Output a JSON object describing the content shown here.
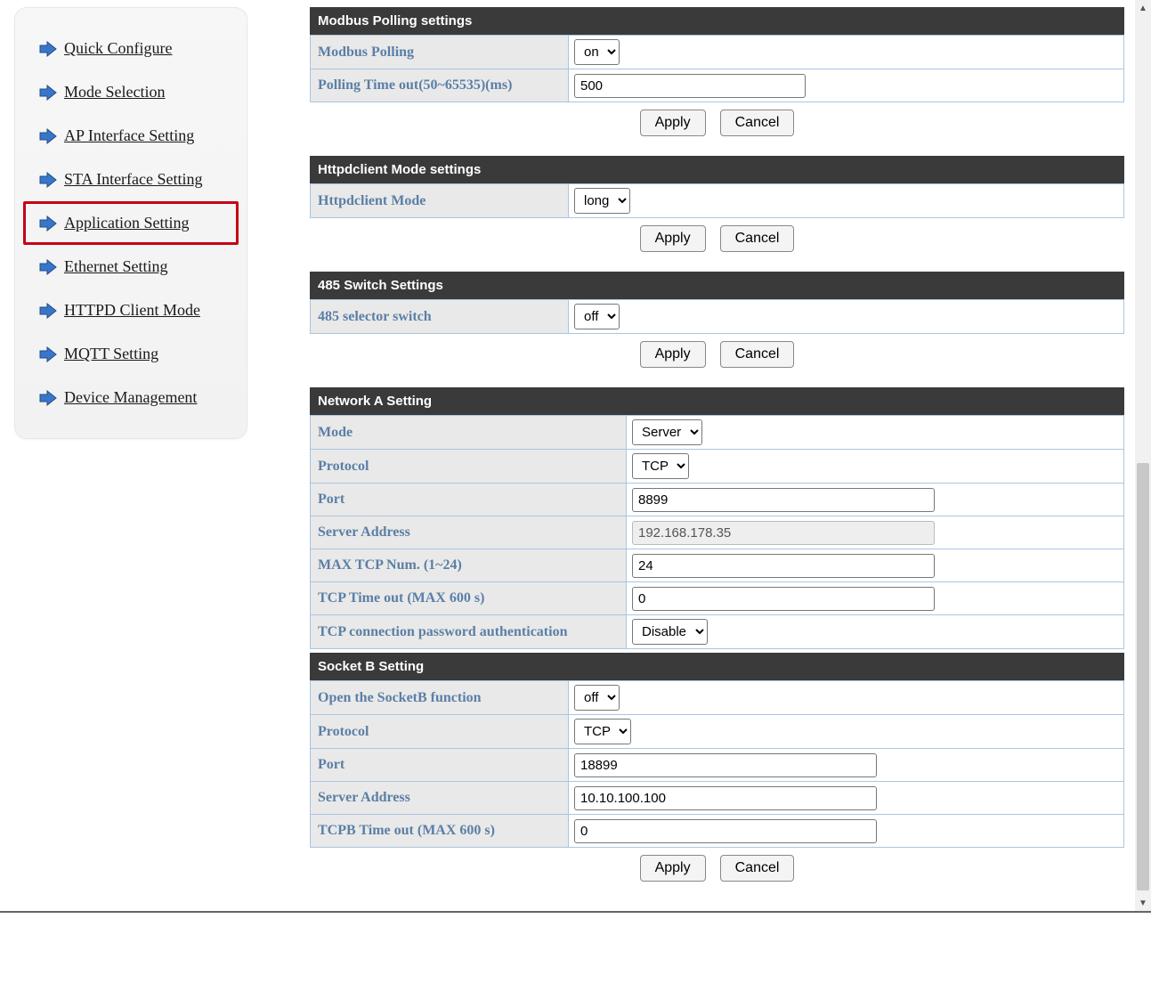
{
  "sidebar": {
    "items": [
      {
        "label": "Quick Configure"
      },
      {
        "label": "Mode Selection"
      },
      {
        "label": "AP Interface Setting"
      },
      {
        "label": "STA Interface Setting"
      },
      {
        "label": "Application Setting",
        "highlighted": true
      },
      {
        "label": "Ethernet Setting"
      },
      {
        "label": "HTTPD Client Mode"
      },
      {
        "label": "MQTT Setting"
      },
      {
        "label": "Device Management"
      }
    ]
  },
  "buttons": {
    "apply": "Apply",
    "cancel": "Cancel"
  },
  "sections": {
    "modbus": {
      "title": "Modbus Polling settings",
      "polling_label": "Modbus Polling",
      "polling_value": "on",
      "timeout_label": "Polling Time out(50~65535)(ms)",
      "timeout_value": "500"
    },
    "httpd": {
      "title": "Httpdclient Mode settings",
      "mode_label": "Httpdclient Mode",
      "mode_value": "long"
    },
    "switch485": {
      "title": "485 Switch Settings",
      "selector_label": "485 selector switch",
      "selector_value": "off"
    },
    "netA": {
      "title": "Network A Setting",
      "mode_label": "Mode",
      "mode_value": "Server",
      "protocol_label": "Protocol",
      "protocol_value": "TCP",
      "port_label": "Port",
      "port_value": "8899",
      "server_label": "Server Address",
      "server_value": "192.168.178.35",
      "maxtcp_label": "MAX TCP Num. (1~24)",
      "maxtcp_value": "24",
      "timeout_label": "TCP Time out (MAX 600 s)",
      "timeout_value": "0",
      "auth_label": "TCP connection password authentication",
      "auth_value": "Disable"
    },
    "socketB": {
      "title": "Socket B Setting",
      "open_label": "Open the SocketB function",
      "open_value": "off",
      "protocol_label": "Protocol",
      "protocol_value": "TCP",
      "port_label": "Port",
      "port_value": "18899",
      "server_label": "Server Address",
      "server_value": "10.10.100.100",
      "timeout_label": "TCPB Time out (MAX 600 s)",
      "timeout_value": "0"
    }
  }
}
